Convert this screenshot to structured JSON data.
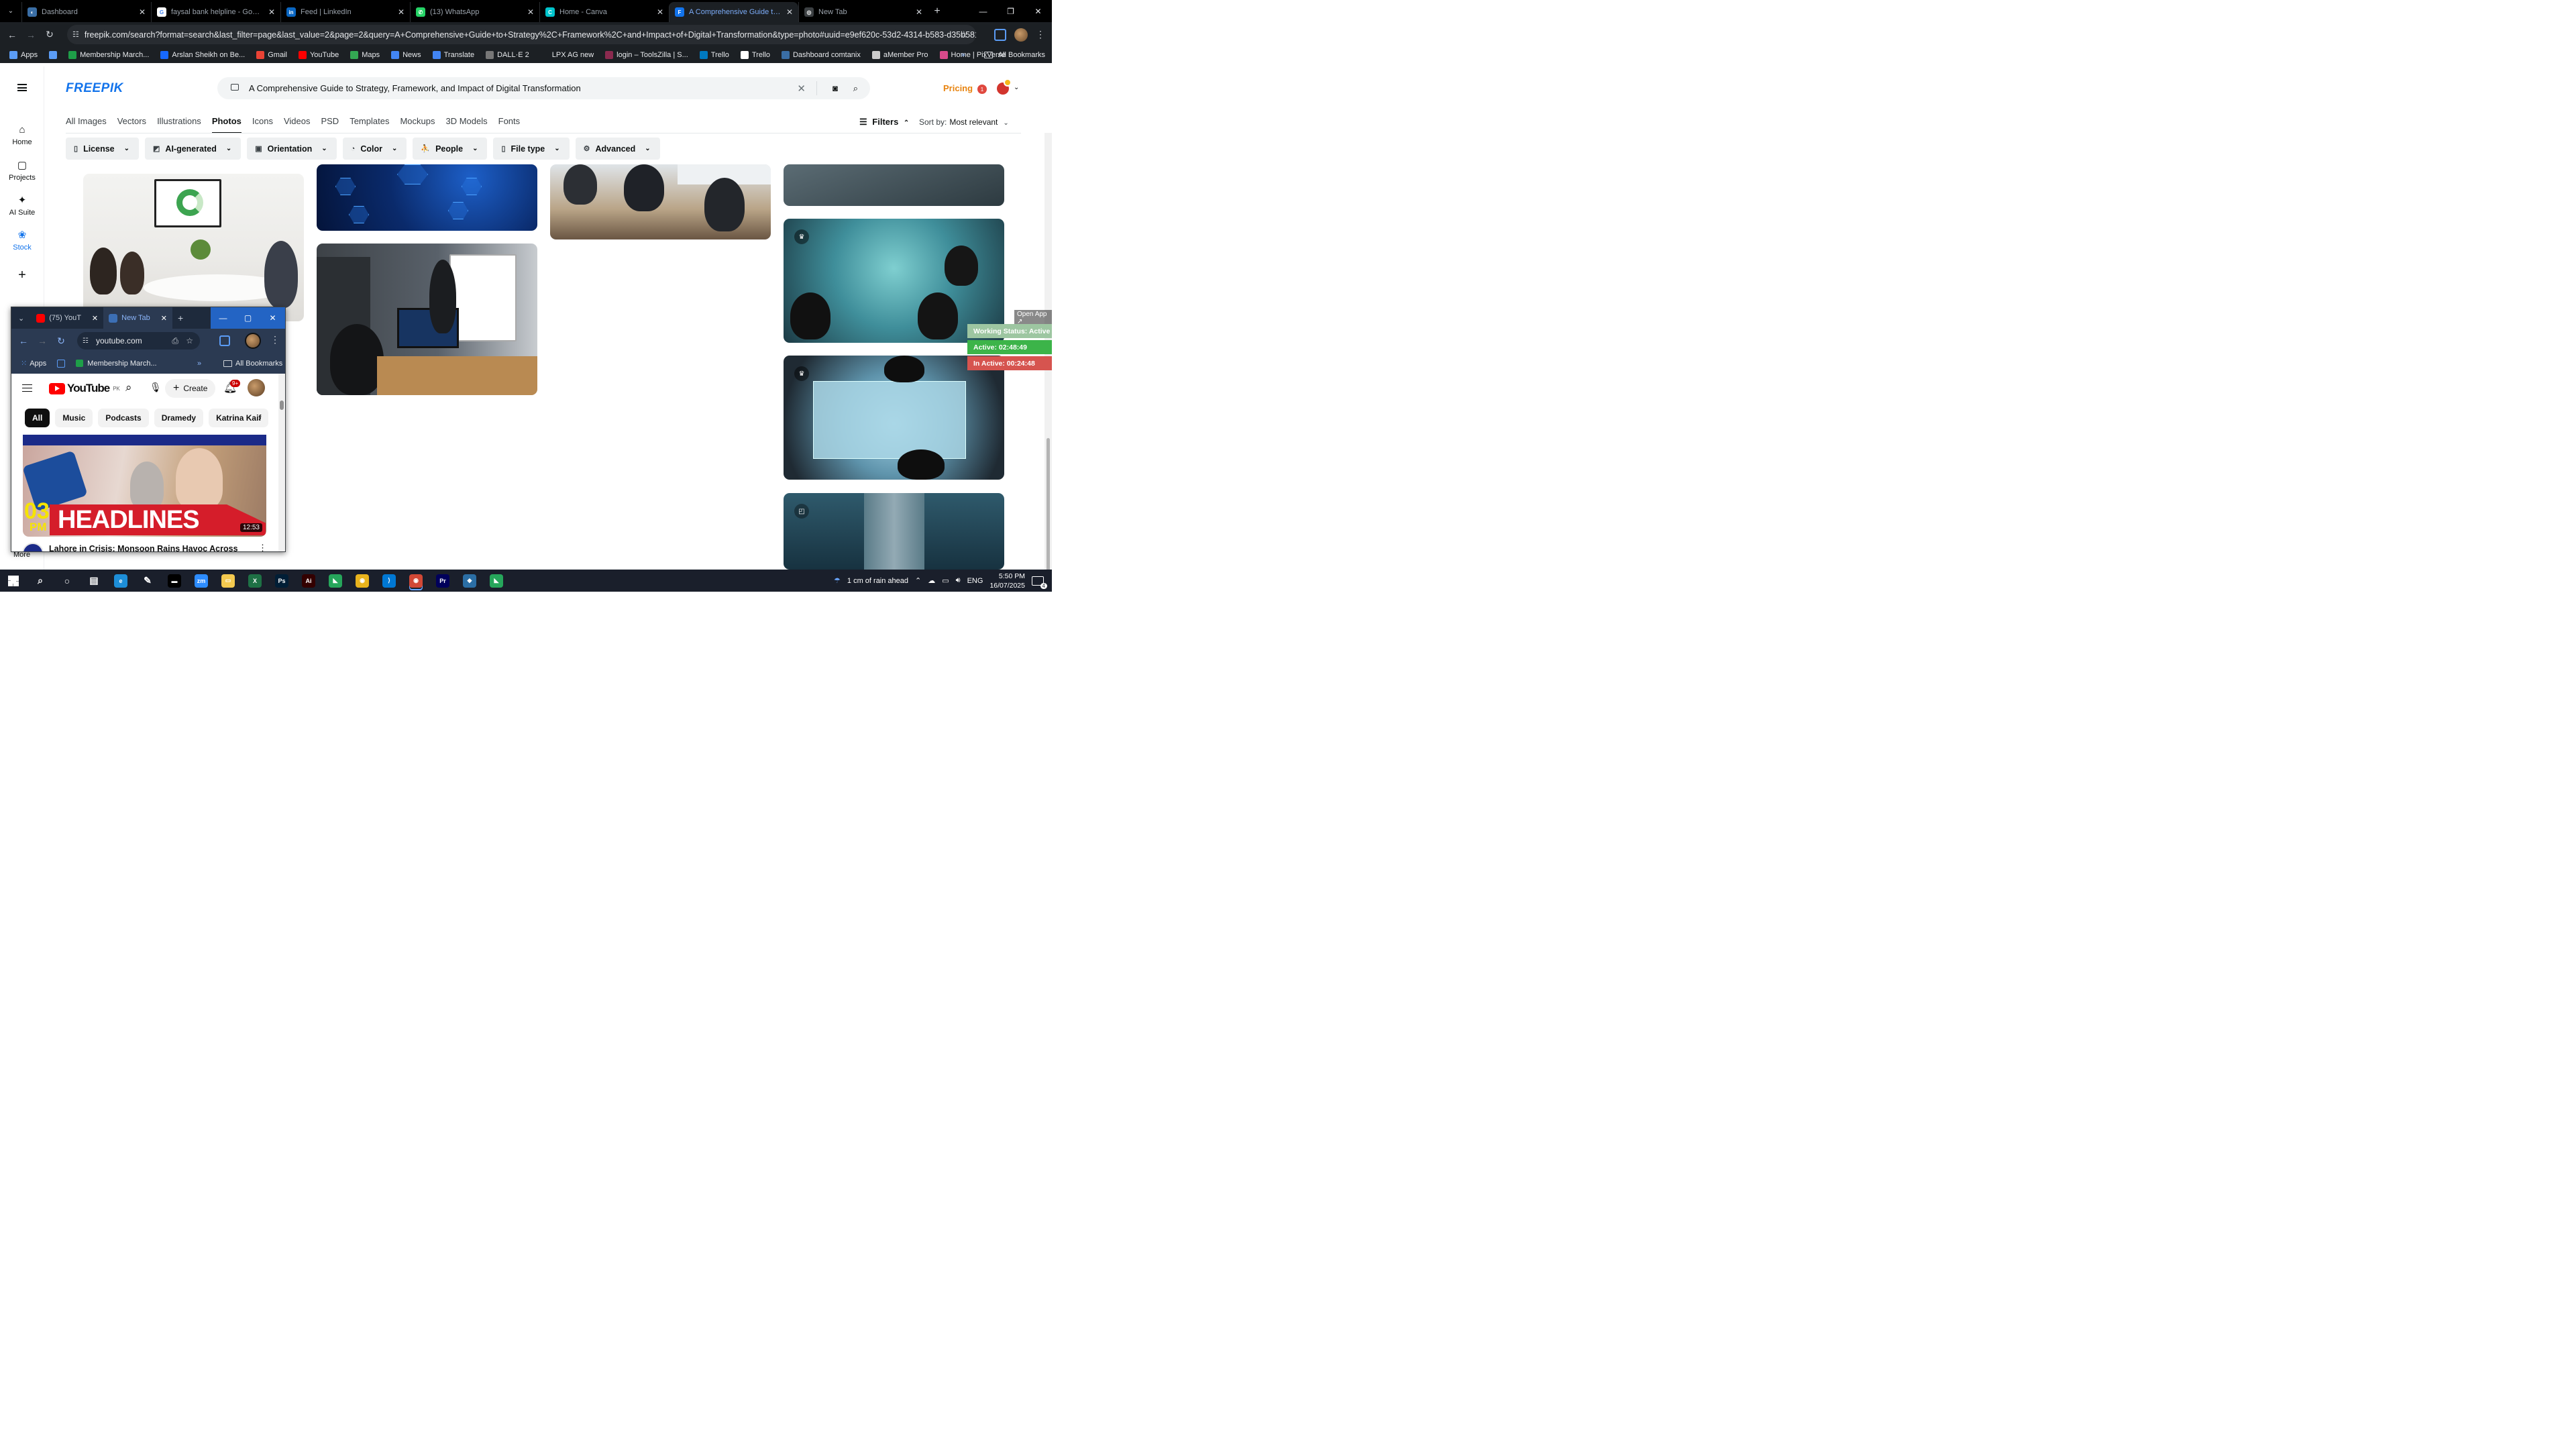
{
  "browser": {
    "tabs": [
      {
        "title": "Dashboard",
        "color": "#3a6ea5",
        "glyph": "◐"
      },
      {
        "title": "faysal bank helpline - Google S",
        "color": "#ffffff",
        "glyph": "G"
      },
      {
        "title": "Feed | LinkedIn",
        "color": "#0a66c2",
        "glyph": "in"
      },
      {
        "title": "(13) WhatsApp",
        "color": "#25d366",
        "glyph": "✆"
      },
      {
        "title": "Home - Canva",
        "color": "#00c4cc",
        "glyph": "C"
      },
      {
        "title": "A Comprehensive Guide to Stra",
        "color": "#1273eb",
        "glyph": "F",
        "active": true
      },
      {
        "title": "New Tab",
        "color": "#3c4043",
        "glyph": "◎"
      }
    ],
    "url": "freepik.com/search?format=search&last_filter=page&last_value=2&page=2&query=A+Comprehensive+Guide+to+Strategy%2C+Framework%2C+and+Impact+of+Digital+Transformation&type=photo#uuid=e9ef620c-53d2-4314-b583-d35b5816fc3d",
    "bookmarks": [
      {
        "label": "Apps",
        "color": "#5b9cf5"
      },
      {
        "label": "",
        "color": "#5b9cf5"
      },
      {
        "label": "Membership March...",
        "color": "#1e9e48"
      },
      {
        "label": "Arslan Sheikh on Be...",
        "color": "#1769ff"
      },
      {
        "label": "Gmail",
        "color": "#ea4335"
      },
      {
        "label": "YouTube",
        "color": "#ff0000"
      },
      {
        "label": "Maps",
        "color": "#34a853"
      },
      {
        "label": "News",
        "color": "#4285f4"
      },
      {
        "label": "Translate",
        "color": "#4285f4"
      },
      {
        "label": "DALL·E 2",
        "color": "#777777"
      },
      {
        "label": "LPX AG new",
        "color": "#1c2024"
      },
      {
        "label": "login – ToolsZilla | S...",
        "color": "#8b2a4f"
      },
      {
        "label": "Trello",
        "color": "#0079bf"
      },
      {
        "label": "Trello",
        "color": "#ffffff"
      },
      {
        "label": "Dashboard comtanix",
        "color": "#3a6ea5"
      },
      {
        "label": "aMember Pro",
        "color": "#cccccc"
      },
      {
        "label": "Home | PixVerse",
        "color": "#d94a8c"
      }
    ],
    "all_bookmarks": "All Bookmarks"
  },
  "freepik": {
    "logo": "FREEPIK",
    "search_query": "A Comprehensive Guide to Strategy, Framework, and Impact of Digital Transformation",
    "pricing": "Pricing",
    "notif_count": "1",
    "rail": [
      {
        "label": "Home",
        "icon": "⌂"
      },
      {
        "label": "Projects",
        "icon": "▢"
      },
      {
        "label": "AI Suite",
        "icon": "✦"
      },
      {
        "label": "Stock",
        "icon": "❀"
      }
    ],
    "more": "More",
    "categories": [
      "All Images",
      "Vectors",
      "Illustrations",
      "Photos",
      "Icons",
      "Videos",
      "PSD",
      "Templates",
      "Mockups",
      "3D Models",
      "Fonts"
    ],
    "active_category": "Photos",
    "filters_label": "Filters",
    "sort_label": "Sort by:",
    "sort_value": "Most relevant",
    "chips": [
      {
        "label": "License",
        "icon": "▯"
      },
      {
        "label": "AI-generated",
        "icon": "◩"
      },
      {
        "label": "Orientation",
        "icon": "▣"
      },
      {
        "label": "Color",
        "icon": "◔"
      },
      {
        "label": "People",
        "icon": "⛹"
      },
      {
        "label": "File type",
        "icon": "▯"
      },
      {
        "label": "Advanced",
        "icon": "⚙"
      }
    ]
  },
  "status_widget": {
    "open_app": "Open App ↗",
    "working": "Working Status: Active",
    "active": "Active: 02:48:49",
    "inactive": "In Active: 00:24:48"
  },
  "popup": {
    "tabs": [
      {
        "title": "(75) YouT",
        "color": "#ff0000"
      },
      {
        "title": "New Tab",
        "color": "#3c6fb5"
      }
    ],
    "url": "youtube.com",
    "bm_apps": "Apps",
    "bm_item": "Membership March...",
    "bm_all": "All Bookmarks",
    "yt_region": "PK",
    "yt_brand": "YouTube",
    "create": "Create",
    "notif": "9+",
    "chips": [
      "All",
      "Music",
      "Podcasts",
      "Dramedy",
      "Katrina Kaif"
    ],
    "thumb_num": "03",
    "thumb_pm": "PM",
    "thumb_headline": "HEADLINES",
    "duration": "12:53",
    "video_title": "Lahore in Crisis: Monsoon Rains Havoc Across"
  },
  "taskbar": {
    "apps": [
      {
        "name": "search",
        "color": "transparent",
        "glyph": "⌕"
      },
      {
        "name": "cortana",
        "color": "transparent",
        "glyph": "○"
      },
      {
        "name": "taskview",
        "color": "transparent",
        "glyph": "▤"
      },
      {
        "name": "edge",
        "color": "#1d8ed8",
        "glyph": "e"
      },
      {
        "name": "pen",
        "color": "transparent",
        "glyph": "✎"
      },
      {
        "name": "terminal",
        "color": "#000000",
        "glyph": "▬"
      },
      {
        "name": "zoom",
        "color": "#2d8cff",
        "glyph": "zm"
      },
      {
        "name": "explorer",
        "color": "#f3c94f",
        "glyph": "▭"
      },
      {
        "name": "excel",
        "color": "#1e7145",
        "glyph": "X"
      },
      {
        "name": "photoshop",
        "color": "#001e36",
        "glyph": "Ps"
      },
      {
        "name": "illustrator",
        "color": "#330000",
        "glyph": "Ai"
      },
      {
        "name": "app-green",
        "color": "#26a65b",
        "glyph": "◣"
      },
      {
        "name": "chrome",
        "color": "#e8b31d",
        "glyph": "◉"
      },
      {
        "name": "vscode",
        "color": "#0078d4",
        "glyph": "⟩"
      },
      {
        "name": "chrome-2",
        "color": "#d14836",
        "glyph": "◉",
        "active": true
      },
      {
        "name": "premiere",
        "color": "#00005b",
        "glyph": "Pr"
      },
      {
        "name": "app-blue",
        "color": "#2b6ea5",
        "glyph": "◆"
      },
      {
        "name": "app-green-2",
        "color": "#26a65b",
        "glyph": "◣"
      }
    ],
    "weather": "1 cm of rain ahead",
    "lang": "ENG",
    "time": "5:50 PM",
    "date": "16/07/2025",
    "notif_count": "4"
  }
}
